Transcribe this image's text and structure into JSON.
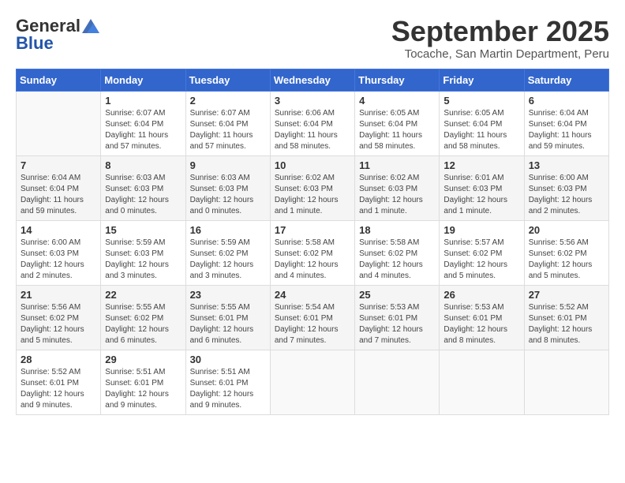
{
  "header": {
    "logo_general": "General",
    "logo_blue": "Blue",
    "month_title": "September 2025",
    "subtitle": "Tocache, San Martin Department, Peru"
  },
  "weekdays": [
    "Sunday",
    "Monday",
    "Tuesday",
    "Wednesday",
    "Thursday",
    "Friday",
    "Saturday"
  ],
  "weeks": [
    [
      {
        "day": "",
        "info": ""
      },
      {
        "day": "1",
        "info": "Sunrise: 6:07 AM\nSunset: 6:04 PM\nDaylight: 11 hours\nand 57 minutes."
      },
      {
        "day": "2",
        "info": "Sunrise: 6:07 AM\nSunset: 6:04 PM\nDaylight: 11 hours\nand 57 minutes."
      },
      {
        "day": "3",
        "info": "Sunrise: 6:06 AM\nSunset: 6:04 PM\nDaylight: 11 hours\nand 58 minutes."
      },
      {
        "day": "4",
        "info": "Sunrise: 6:05 AM\nSunset: 6:04 PM\nDaylight: 11 hours\nand 58 minutes."
      },
      {
        "day": "5",
        "info": "Sunrise: 6:05 AM\nSunset: 6:04 PM\nDaylight: 11 hours\nand 58 minutes."
      },
      {
        "day": "6",
        "info": "Sunrise: 6:04 AM\nSunset: 6:04 PM\nDaylight: 11 hours\nand 59 minutes."
      }
    ],
    [
      {
        "day": "7",
        "info": "Sunrise: 6:04 AM\nSunset: 6:04 PM\nDaylight: 11 hours\nand 59 minutes."
      },
      {
        "day": "8",
        "info": "Sunrise: 6:03 AM\nSunset: 6:03 PM\nDaylight: 12 hours\nand 0 minutes."
      },
      {
        "day": "9",
        "info": "Sunrise: 6:03 AM\nSunset: 6:03 PM\nDaylight: 12 hours\nand 0 minutes."
      },
      {
        "day": "10",
        "info": "Sunrise: 6:02 AM\nSunset: 6:03 PM\nDaylight: 12 hours\nand 1 minute."
      },
      {
        "day": "11",
        "info": "Sunrise: 6:02 AM\nSunset: 6:03 PM\nDaylight: 12 hours\nand 1 minute."
      },
      {
        "day": "12",
        "info": "Sunrise: 6:01 AM\nSunset: 6:03 PM\nDaylight: 12 hours\nand 1 minute."
      },
      {
        "day": "13",
        "info": "Sunrise: 6:00 AM\nSunset: 6:03 PM\nDaylight: 12 hours\nand 2 minutes."
      }
    ],
    [
      {
        "day": "14",
        "info": "Sunrise: 6:00 AM\nSunset: 6:03 PM\nDaylight: 12 hours\nand 2 minutes."
      },
      {
        "day": "15",
        "info": "Sunrise: 5:59 AM\nSunset: 6:03 PM\nDaylight: 12 hours\nand 3 minutes."
      },
      {
        "day": "16",
        "info": "Sunrise: 5:59 AM\nSunset: 6:02 PM\nDaylight: 12 hours\nand 3 minutes."
      },
      {
        "day": "17",
        "info": "Sunrise: 5:58 AM\nSunset: 6:02 PM\nDaylight: 12 hours\nand 4 minutes."
      },
      {
        "day": "18",
        "info": "Sunrise: 5:58 AM\nSunset: 6:02 PM\nDaylight: 12 hours\nand 4 minutes."
      },
      {
        "day": "19",
        "info": "Sunrise: 5:57 AM\nSunset: 6:02 PM\nDaylight: 12 hours\nand 5 minutes."
      },
      {
        "day": "20",
        "info": "Sunrise: 5:56 AM\nSunset: 6:02 PM\nDaylight: 12 hours\nand 5 minutes."
      }
    ],
    [
      {
        "day": "21",
        "info": "Sunrise: 5:56 AM\nSunset: 6:02 PM\nDaylight: 12 hours\nand 5 minutes."
      },
      {
        "day": "22",
        "info": "Sunrise: 5:55 AM\nSunset: 6:02 PM\nDaylight: 12 hours\nand 6 minutes."
      },
      {
        "day": "23",
        "info": "Sunrise: 5:55 AM\nSunset: 6:01 PM\nDaylight: 12 hours\nand 6 minutes."
      },
      {
        "day": "24",
        "info": "Sunrise: 5:54 AM\nSunset: 6:01 PM\nDaylight: 12 hours\nand 7 minutes."
      },
      {
        "day": "25",
        "info": "Sunrise: 5:53 AM\nSunset: 6:01 PM\nDaylight: 12 hours\nand 7 minutes."
      },
      {
        "day": "26",
        "info": "Sunrise: 5:53 AM\nSunset: 6:01 PM\nDaylight: 12 hours\nand 8 minutes."
      },
      {
        "day": "27",
        "info": "Sunrise: 5:52 AM\nSunset: 6:01 PM\nDaylight: 12 hours\nand 8 minutes."
      }
    ],
    [
      {
        "day": "28",
        "info": "Sunrise: 5:52 AM\nSunset: 6:01 PM\nDaylight: 12 hours\nand 9 minutes."
      },
      {
        "day": "29",
        "info": "Sunrise: 5:51 AM\nSunset: 6:01 PM\nDaylight: 12 hours\nand 9 minutes."
      },
      {
        "day": "30",
        "info": "Sunrise: 5:51 AM\nSunset: 6:01 PM\nDaylight: 12 hours\nand 9 minutes."
      },
      {
        "day": "",
        "info": ""
      },
      {
        "day": "",
        "info": ""
      },
      {
        "day": "",
        "info": ""
      },
      {
        "day": "",
        "info": ""
      }
    ]
  ]
}
